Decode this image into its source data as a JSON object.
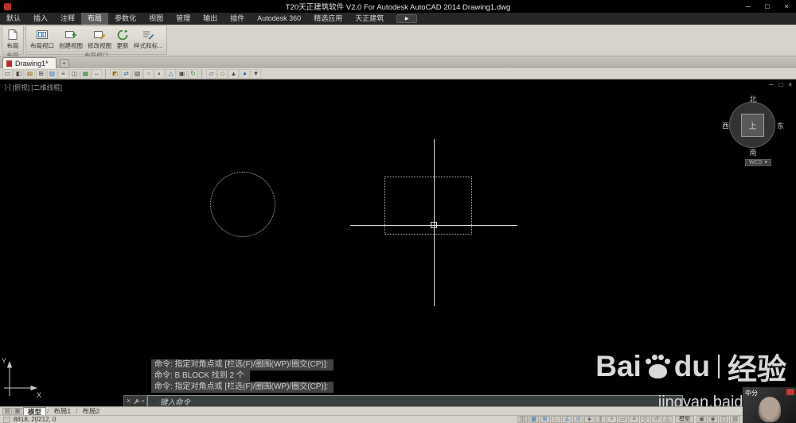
{
  "title_bar": {
    "app_title": "T20天正建筑软件 V2.0 For Autodesk AutoCAD 2014 Drawing1.dwg",
    "minimize": "─",
    "maximize": "□",
    "close": "×"
  },
  "ribbon_tabs": {
    "items": [
      "默认",
      "插入",
      "注释",
      "布局",
      "参数化",
      "视图",
      "管理",
      "输出",
      "插件",
      "Autodesk 360",
      "精选应用",
      "天正建筑"
    ],
    "active": "布局",
    "play": "▶"
  },
  "ribbon": {
    "panels": [
      {
        "title": "布局",
        "tools": [
          {
            "label": "布局",
            "icon": "layout-page-icon"
          }
        ]
      },
      {
        "title": "布局视口",
        "tools": [
          {
            "label": "布局视口",
            "icon": "viewport-icon"
          },
          {
            "label": "创建视图",
            "icon": "create-view-icon"
          },
          {
            "label": "修改视图",
            "icon": "modify-view-icon"
          },
          {
            "label": "更新",
            "icon": "update-icon"
          },
          {
            "label": "样式和标...",
            "icon": "styles-icon"
          }
        ]
      }
    ]
  },
  "file_tabs": {
    "active_tab": "Drawing1*",
    "new_tab": "+"
  },
  "toolbar": {
    "icons": [
      {
        "g": "▭",
        "c": "#4a4a4a"
      },
      {
        "g": "◧",
        "c": "#4a4a4a"
      },
      {
        "g": "▤",
        "c": "#a07414"
      },
      {
        "g": "⊞",
        "c": "#4a4a4a"
      },
      {
        "g": "▥",
        "c": "#2f74b5"
      },
      {
        "g": "≡",
        "c": "#4a4a4a"
      },
      {
        "g": "◫",
        "c": "#4a4a4a"
      },
      {
        "g": "▦",
        "c": "#3a8a3a"
      },
      {
        "g": "↔",
        "c": "#4a4a4a"
      },
      {
        "g": "◩",
        "c": "#a07414"
      },
      {
        "g": "⇄",
        "c": "#2f74b5"
      },
      {
        "g": "▨",
        "c": "#4a4a4a"
      },
      {
        "g": "○",
        "c": "#a33b3b"
      },
      {
        "g": "◐",
        "c": "#4a4a4a"
      },
      {
        "g": "△",
        "c": "#2f74b5"
      },
      {
        "g": "▣",
        "c": "#4a4a4a"
      },
      {
        "g": "↻",
        "c": "#3a8a3a"
      },
      {
        "g": "▱",
        "c": "#4a4a4a"
      },
      {
        "g": "◇",
        "c": "#a07414"
      },
      {
        "g": "▲",
        "c": "#4a4a4a"
      },
      {
        "g": "●",
        "c": "#2f74b5"
      },
      {
        "g": "▼",
        "c": "#4a4a4a"
      }
    ]
  },
  "viewport": {
    "controls": [
      "[-]",
      "[俯视]",
      "[二维线框]"
    ],
    "window_controls": {
      "minimize": "─",
      "restore": "□",
      "close": "×"
    },
    "viewcube": {
      "north": "北",
      "south": "南",
      "east": "东",
      "west": "西",
      "center": "上"
    },
    "wcs": "WCS",
    "wcs_caret": "▾",
    "ucs_labels": {
      "x": "X",
      "y": "Y"
    }
  },
  "command": {
    "history": [
      "命令: 指定对角点或 [栏选(F)/圈围(WP)/圈交(CP)]:",
      "命令: B BLOCK 找到 2 个",
      "命令: 指定对角点或 [栏选(F)/圈围(WP)/圈交(CP)]:"
    ],
    "close": "×",
    "customize_caret": "▾",
    "prompt": ">",
    "placeholder": "键入命令"
  },
  "watermark": {
    "part1": "Bai",
    "part2": "du",
    "suffix": "经验",
    "url": "jingyan.baidu.com"
  },
  "ad": {
    "caption": "中分"
  },
  "layout_tabs": {
    "icons": [
      {
        "g": "▤"
      },
      {
        "g": "▦"
      }
    ],
    "items": [
      "模型",
      "布局1",
      "布局2"
    ],
    "active": "模型",
    "separator": "/"
  },
  "status_bar": {
    "coordinates": "8818, 20212, 0",
    "toggles": [
      {
        "g": "◫",
        "c": "#5a5a5a"
      },
      {
        "g": "▦",
        "c": "#2f74b5"
      },
      {
        "g": "⊞",
        "c": "#2f74b5"
      },
      {
        "g": "∟",
        "c": "#5a5a5a"
      },
      {
        "g": "∠",
        "c": "#2f74b5"
      },
      {
        "g": "⊙",
        "c": "#2f74b5"
      },
      {
        "g": "◈",
        "c": "#5a5a5a"
      },
      {
        "g": "∥",
        "c": "#5a5a5a"
      },
      {
        "g": "+",
        "c": "#2f74b5"
      },
      {
        "g": "▭",
        "c": "#5a5a5a"
      },
      {
        "g": "≡",
        "c": "#5a5a5a"
      },
      {
        "g": "◇",
        "c": "#5a5a5a"
      },
      {
        "g": "↺",
        "c": "#5a5a5a"
      },
      {
        "g": "△",
        "c": "#5a5a5a"
      }
    ],
    "model_button": "模型",
    "right_icons": [
      {
        "g": "▣",
        "c": "#5a5a5a"
      },
      {
        "g": "◉",
        "c": "#5a5a5a"
      },
      {
        "g": "▢",
        "c": "#5a5a5a"
      },
      {
        "g": "▤",
        "c": "#5a5a5a"
      }
    ]
  },
  "colors": {
    "canvas_bg": "#000000",
    "ribbon_bg": "#d6d3cb",
    "accent_blue": "#2f74b5",
    "crosshair": "#dcdcdc"
  }
}
